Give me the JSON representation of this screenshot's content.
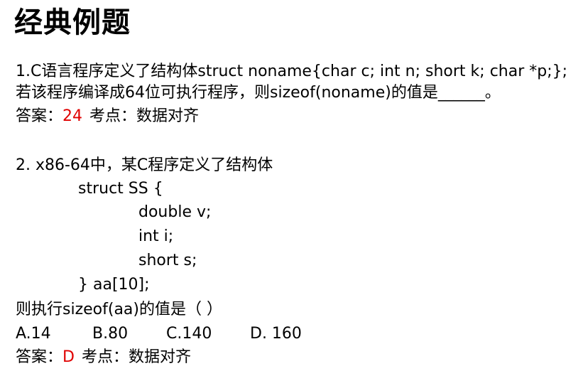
{
  "page": {
    "title": "经典例题"
  },
  "q1": {
    "line1": "1.C语言程序定义了结构体struct noname{char c; int n; short k; char *p;};",
    "line2": "若该程序编译成64位可执行程序，则sizeof(noname)的值是______。",
    "answer_label": "答案：",
    "answer_value": "24",
    "topic": "考点：数据对齐"
  },
  "q2": {
    "line1": "2. x86-64中，某C程序定义了结构体",
    "code": [
      "struct SS {",
      "double v;",
      "int i;",
      "short s;",
      "} aa[10];"
    ],
    "question": "则执行sizeof(aa)的值是（   ）",
    "options": [
      "A.14",
      "B.80",
      "C.140",
      "D. 160"
    ],
    "answer_label": "答案：",
    "answer_value": "D",
    "topic": "考点：数据对齐"
  },
  "colors": {
    "text": "#000000",
    "answer_accent": "#e00000",
    "background": "#ffffff"
  }
}
